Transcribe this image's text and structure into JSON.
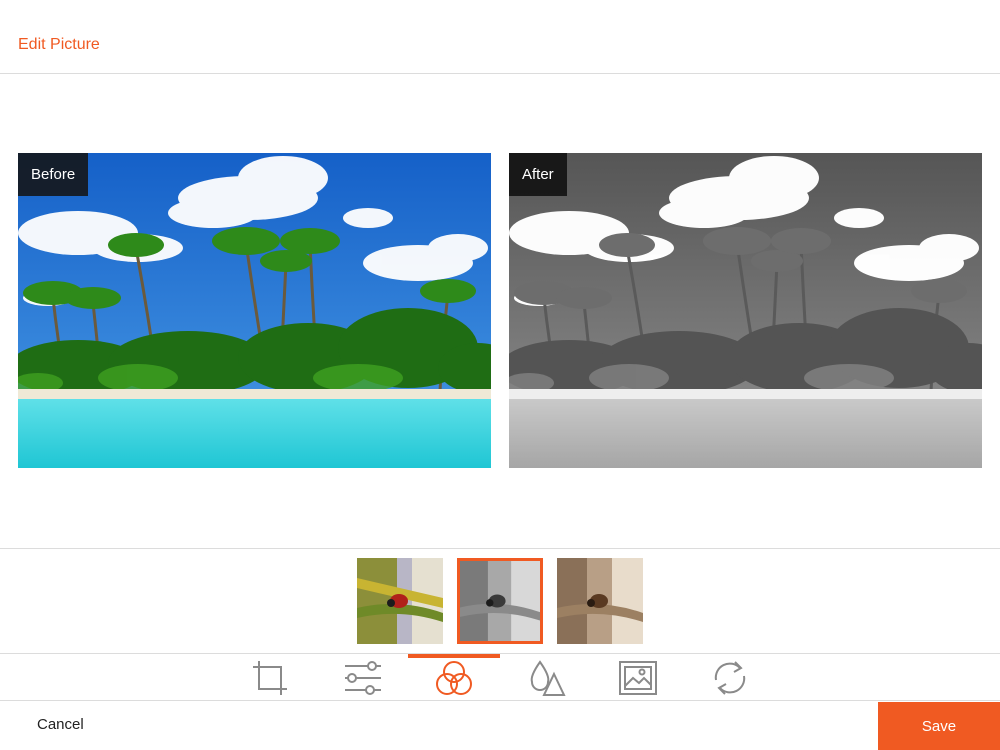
{
  "header": {
    "title": "Edit Picture"
  },
  "preview": {
    "before_label": "Before",
    "after_label": "After"
  },
  "filters": {
    "selected_index": 1,
    "count": 3
  },
  "toolbar": {
    "tools": [
      "crop-icon",
      "adjust-sliders-icon",
      "filters-icon",
      "color-drops-icon",
      "image-frame-icon",
      "rotate-icon"
    ],
    "active_tool": "filters-icon"
  },
  "footer": {
    "cancel_label": "Cancel",
    "save_label": "Save"
  },
  "colors": {
    "accent": "#f05a22",
    "divider": "#dcdcdc",
    "text": "#222222"
  }
}
